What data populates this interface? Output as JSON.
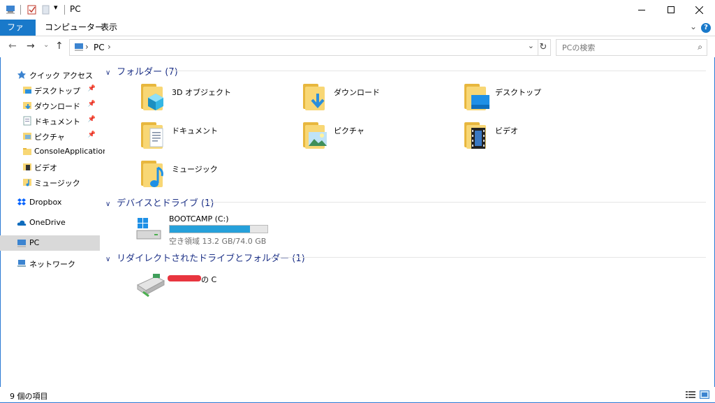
{
  "window": {
    "title": "PC"
  },
  "ribbon": {
    "tabs": [
      "ファイル",
      "コンピューター",
      "表示"
    ],
    "help": "?"
  },
  "nav": {
    "path": "PC",
    "separator": "›"
  },
  "search": {
    "placeholder": "PCの検索"
  },
  "sidebar": {
    "quick_access": "クイック アクセス",
    "items": [
      {
        "label": "デスクトップ",
        "pinned": true
      },
      {
        "label": "ダウンロード",
        "pinned": true
      },
      {
        "label": "ドキュメント",
        "pinned": true
      },
      {
        "label": "ピクチャ",
        "pinned": true
      },
      {
        "label": "ConsoleApplication",
        "pinned": false
      },
      {
        "label": "ビデオ",
        "pinned": false
      },
      {
        "label": "ミュージック",
        "pinned": false
      }
    ],
    "dropbox": "Dropbox",
    "onedrive": "OneDrive",
    "pc": "PC",
    "network": "ネットワーク"
  },
  "groups": {
    "folders": {
      "title": "フォルダー (7)"
    },
    "drives": {
      "title": "デバイスとドライブ (1)"
    },
    "redirected": {
      "title": "リダイレクトされたドライブとフォルダー (1)"
    }
  },
  "folders": [
    {
      "label": "3D オブジェクト",
      "icon": "3d-objects-icon"
    },
    {
      "label": "ダウンロード",
      "icon": "download-arrow-icon"
    },
    {
      "label": "デスクトップ",
      "icon": "desktop-icon"
    },
    {
      "label": "ドキュメント",
      "icon": "document-icon"
    },
    {
      "label": "ピクチャ",
      "icon": "picture-icon"
    },
    {
      "label": "ビデオ",
      "icon": "film-icon"
    },
    {
      "label": "ミュージック",
      "icon": "music-note-icon"
    }
  ],
  "drive": {
    "name": "BOOTCAMP (C:)",
    "free_text": "空き領域 13.2 GB/74.0 GB",
    "free_gb": 13.2,
    "total_gb": 74.0
  },
  "redirected_drive": {
    "label_suffix": "の C"
  },
  "status": {
    "items": "9 個の項目"
  },
  "colors": {
    "accent": "#1979ca",
    "group_header": "#1e3287",
    "drive_fill": "#26a0da",
    "redaction": "#e8353f"
  }
}
